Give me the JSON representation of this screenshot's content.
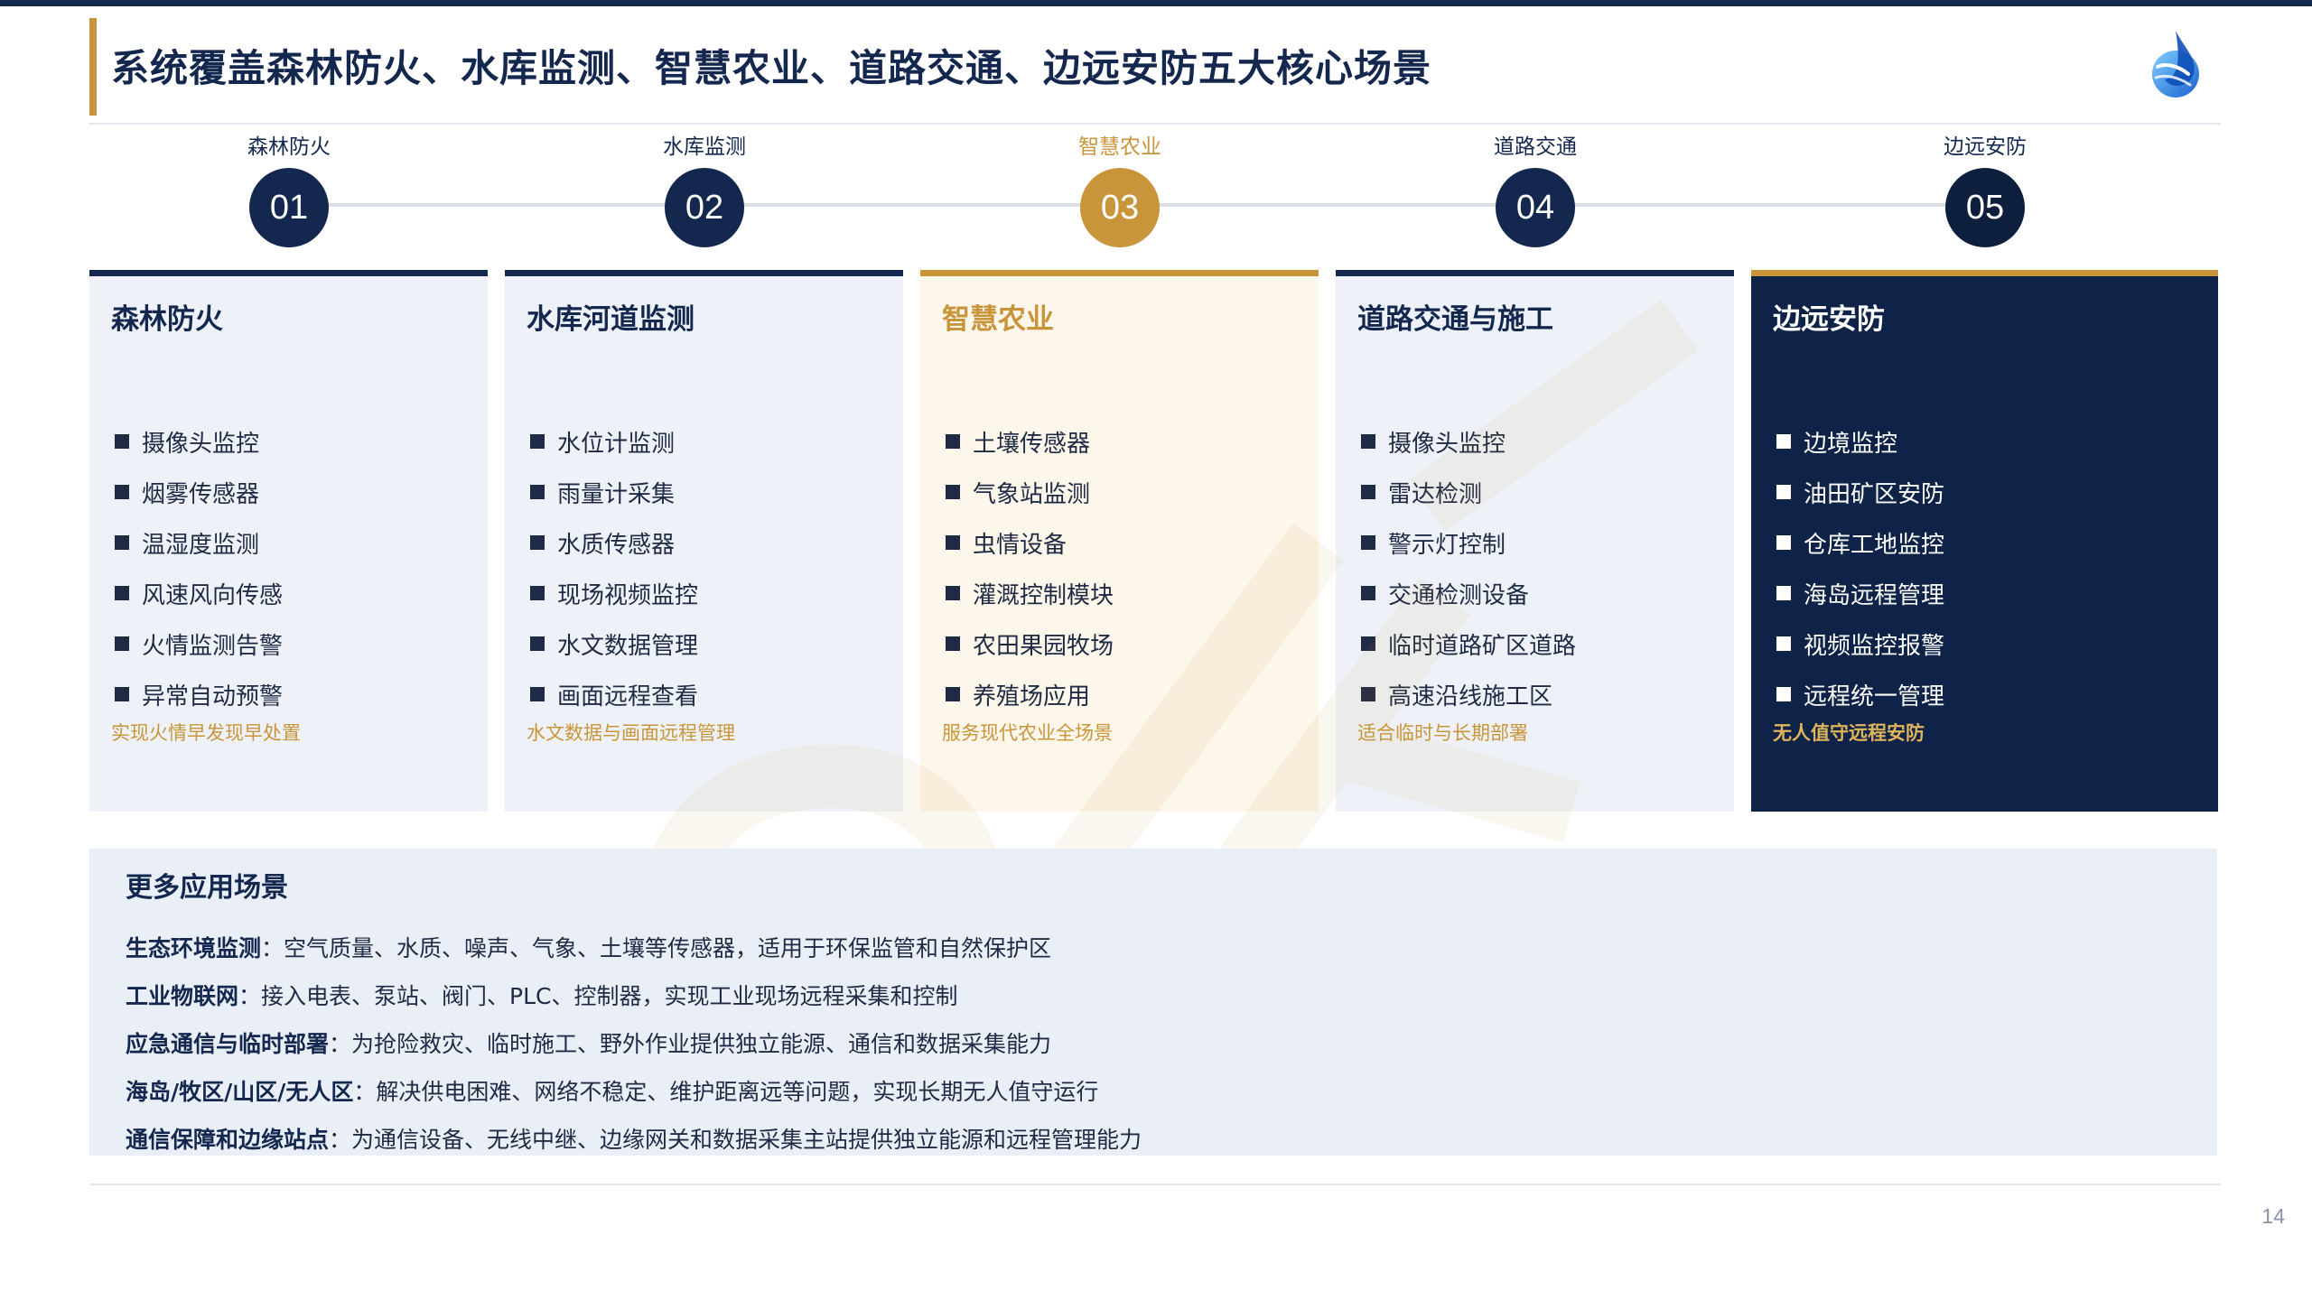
{
  "header": {
    "title": "系统覆盖森林防火、水库监测、智慧农业、道路交通、边远安防五大核心场景",
    "logo_icon": "water-drop-globe-logo"
  },
  "timeline": [
    {
      "label": "森林防火",
      "number": "01"
    },
    {
      "label": "水库监测",
      "number": "02"
    },
    {
      "label": "智慧农业",
      "number": "03"
    },
    {
      "label": "道路交通",
      "number": "04"
    },
    {
      "label": "边远安防",
      "number": "05"
    }
  ],
  "cards": [
    {
      "title": "森林防火",
      "items": [
        "摄像头监控",
        "烟雾传感器",
        "温湿度监测",
        "风速风向传感",
        "火情监测告警",
        "异常自动预警"
      ],
      "note": "实现火情早发现早处置"
    },
    {
      "title": "水库河道监测",
      "items": [
        "水位计监测",
        "雨量计采集",
        "水质传感器",
        "现场视频监控",
        "水文数据管理",
        "画面远程查看"
      ],
      "note": "水文数据与画面远程管理"
    },
    {
      "title": "智慧农业",
      "items": [
        "土壤传感器",
        "气象站监测",
        "虫情设备",
        "灌溉控制模块",
        "农田果园牧场",
        "养殖场应用"
      ],
      "note": "服务现代农业全场景"
    },
    {
      "title": "道路交通与施工",
      "items": [
        "摄像头监控",
        "雷达检测",
        "警示灯控制",
        "交通检测设备",
        "临时道路矿区道路",
        "高速沿线施工区"
      ],
      "note": "适合临时与长期部署"
    },
    {
      "title": "边远安防",
      "items": [
        "边境监控",
        "油田矿区安防",
        "仓库工地监控",
        "海岛远程管理",
        "视频监控报警",
        "远程统一管理"
      ],
      "note": "无人值守远程安防"
    }
  ],
  "more": {
    "title": "更多应用场景",
    "items": [
      {
        "key": "生态环境监测",
        "text": "：空气质量、水质、噪声、气象、土壤等传感器，适用于环保监管和自然保护区"
      },
      {
        "key": "工业物联网",
        "text": "：接入电表、泵站、阀门、PLC、控制器，实现工业现场远程采集和控制"
      },
      {
        "key": "应急通信与临时部署",
        "text": "：为抢险救灾、临时施工、野外作业提供独立能源、通信和数据采集能力"
      },
      {
        "key": "海岛/牧区/山区/无人区",
        "text": "：解决供电困难、网络不稳定、维护距离远等问题，实现长期无人值守运行"
      },
      {
        "key": "通信保障和边缘站点",
        "text": "：为通信设备、无线中继、边缘网关和数据采集主站提供独立能源和远程管理能力"
      }
    ]
  },
  "page_number": "14",
  "colors": {
    "navy": "#14284f",
    "gold": "#c9953a",
    "dark_navy": "#0f2247"
  }
}
